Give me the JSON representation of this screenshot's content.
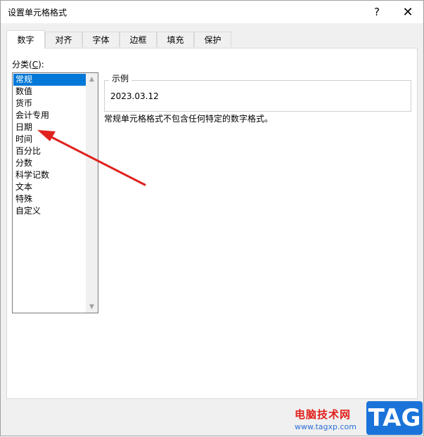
{
  "window": {
    "title": "设置单元格格式",
    "help_label": "?",
    "close_label": "✕"
  },
  "tabs": [
    {
      "label": "数字",
      "active": true
    },
    {
      "label": "对齐"
    },
    {
      "label": "字体"
    },
    {
      "label": "边框"
    },
    {
      "label": "填充"
    },
    {
      "label": "保护"
    }
  ],
  "category": {
    "label_prefix": "分类(",
    "label_key": "C",
    "label_suffix": "):",
    "items": [
      "常规",
      "数值",
      "货币",
      "会计专用",
      "日期",
      "时间",
      "百分比",
      "分数",
      "科学记数",
      "文本",
      "特殊",
      "自定义"
    ],
    "selected_index": 0
  },
  "sample": {
    "legend": "示例",
    "value": "2023.03.12"
  },
  "description": "常规单元格格式不包含任何特定的数字格式。",
  "annotation": {
    "color": "#e0221d"
  },
  "watermark": {
    "site_name": "电脑技术网",
    "url": "www.tagxp.com",
    "badge": "TAG"
  }
}
